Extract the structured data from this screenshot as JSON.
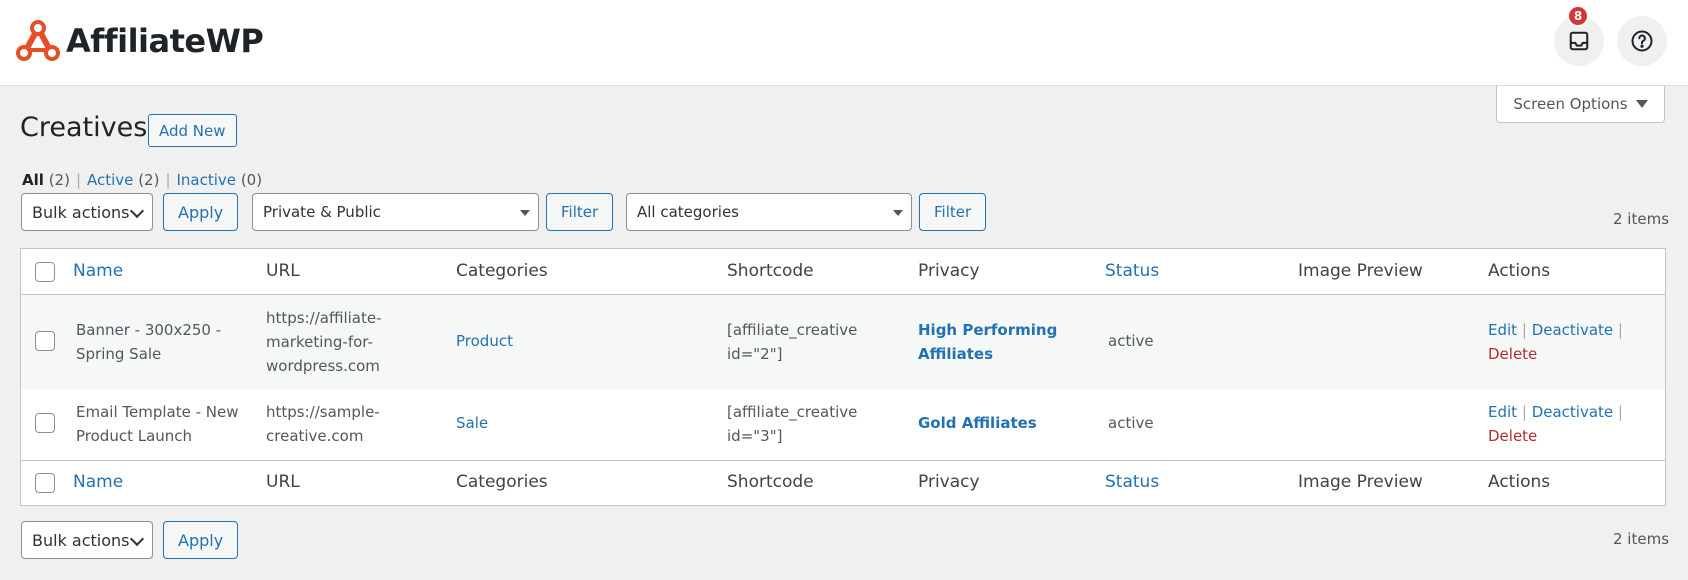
{
  "brand": {
    "name": "AffiliateWP",
    "accent": "#e34f26"
  },
  "topbar": {
    "notification_count": "8",
    "inbox_icon": "inbox-icon",
    "help_icon": "help-icon"
  },
  "screen_options": {
    "label": "Screen Options"
  },
  "page": {
    "title": "Creatives",
    "add_new_label": "Add New"
  },
  "views": [
    {
      "label": "All",
      "count": "(2)"
    },
    {
      "label": "Active",
      "count": "(2)"
    },
    {
      "label": "Inactive",
      "count": "(0)"
    }
  ],
  "filters": {
    "bulk_actions": "Bulk actions",
    "apply": "Apply",
    "privacy_select": "Private & Public",
    "privacy_filter": "Filter",
    "category_select": "All categories",
    "category_filter": "Filter",
    "items_count": "2 items"
  },
  "table": {
    "columns": [
      "Name",
      "URL",
      "Categories",
      "Shortcode",
      "Privacy",
      "Status",
      "Image Preview",
      "Actions"
    ],
    "rows": [
      {
        "name_line1": "Banner - 300x250 -",
        "name_line2": "Spring Sale",
        "url_line1": "https://affiliate-",
        "url_line2": "marketing-for-",
        "url_line3": "wordpress.com",
        "category": "Product",
        "shortcode_line1": "[affiliate_creative",
        "shortcode_line2": "id=\"2\"]",
        "privacy_line1": "High Performing",
        "privacy_line2": "Affiliates",
        "status": "active",
        "action_edit": "Edit",
        "action_deactivate": "Deactivate",
        "action_delete": "Delete"
      },
      {
        "name_line1": "Email Template - New",
        "name_line2": "Product Launch",
        "url_line1": "https://sample-",
        "url_line2": "creative.com",
        "category": "Sale",
        "shortcode_line1": "[affiliate_creative",
        "shortcode_line2": "id=\"3\"]",
        "privacy_line1": "Gold Affiliates",
        "status": "active",
        "action_edit": "Edit",
        "action_deactivate": "Deactivate",
        "action_delete": "Delete"
      }
    ]
  },
  "bottom": {
    "bulk_actions": "Bulk actions",
    "apply": "Apply",
    "items_count": "2 items"
  }
}
